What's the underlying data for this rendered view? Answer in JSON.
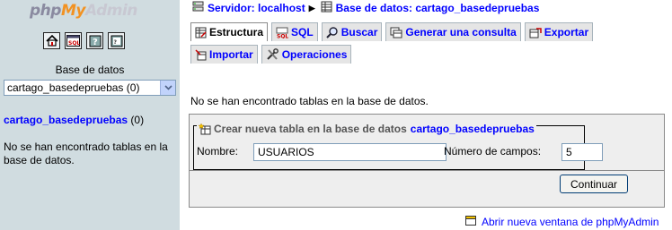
{
  "left": {
    "logo": {
      "php": "php",
      "my": "My",
      "admin": "Admin"
    },
    "icon_buttons": [
      "home-icon",
      "sql-query-icon",
      "help-icon",
      "sql-docs-icon"
    ],
    "db_label": "Base de datos",
    "db_select_value": "cartago_basedepruebas (0)",
    "db_link": "cartago_basedepruebas",
    "db_count": "(0)",
    "no_tables_msg": "No se han encontrado tablas en la base de datos."
  },
  "breadcrumb": {
    "server": "Servidor: localhost",
    "database": "Base de datos: cartago_basedepruebas"
  },
  "tabs": [
    {
      "label": "Estructura",
      "icon": "structure-icon",
      "active": true
    },
    {
      "label": "SQL",
      "icon": "sql-icon",
      "active": false
    },
    {
      "label": "Buscar",
      "icon": "search-icon",
      "active": false
    },
    {
      "label": "Generar una consulta",
      "icon": "query-icon",
      "active": false
    },
    {
      "label": "Exportar",
      "icon": "export-icon",
      "active": false
    },
    {
      "label": "Importar",
      "icon": "import-icon",
      "active": false
    },
    {
      "label": "Operaciones",
      "icon": "operations-icon",
      "active": false
    }
  ],
  "main": {
    "no_tables_msg": "No se han encontrado tablas en la base de datos."
  },
  "create_table": {
    "legend": "Crear nueva tabla en la base de datos",
    "legend_db": "cartago_basedepruebas",
    "name_label": "Nombre:",
    "name_value": "USUARIOS",
    "fields_label": "Número de campos:",
    "fields_value": "5",
    "submit_label": "Continuar"
  },
  "footer": {
    "new_window_link": "Abrir nueva ventana de phpMyAdmin"
  },
  "colors": {
    "left_bg": "#d0dce0",
    "link": "#0000ff",
    "box_bg": "#eeeeee"
  }
}
